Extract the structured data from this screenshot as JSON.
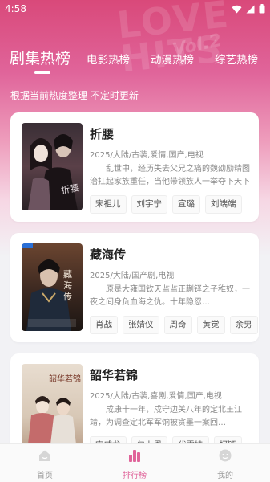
{
  "status_bar": {
    "time": "4:58"
  },
  "tabs": [
    {
      "label": "剧集热榜",
      "active": true
    },
    {
      "label": "电影热榜",
      "active": false
    },
    {
      "label": "动漫热榜",
      "active": false
    },
    {
      "label": "综艺热榜",
      "active": false
    }
  ],
  "subtitle": "根据当前热度整理 不定时更新",
  "items": [
    {
      "title": "折腰",
      "meta": "2025/大陆/古装,爱情,国产,电视",
      "description": "乱世中，经历失去父兄之痛的魏劭励精图治扛起家族重任，当他带领族人一举夺下天下大半江山之时，",
      "cast": [
        "宋祖儿",
        "刘宇宁",
        "宣璐",
        "刘端端"
      ]
    },
    {
      "title": "藏海传",
      "meta": "2025/大陆/国产剧,电视",
      "description": "原是大雍国钦天监监正蒯铎之子稚奴，一夜之间身负血海之仇。十年隐忍…",
      "cast": [
        "肖战",
        "张婧仪",
        "周奇",
        "黄觉",
        "余男"
      ]
    },
    {
      "title": "韶华若锦",
      "meta": "2025/大陆/古装,喜剧,爱情,国产,电视",
      "description": "成康十一年，戍守边关八年的定北王江靖，为调查定北军军饷被贪墨一案回…",
      "cast": [
        "宋威龙",
        "包上恩",
        "代露娃",
        "柯颖"
      ]
    }
  ],
  "bottom_nav": [
    {
      "label": "首页",
      "icon": "home-icon",
      "active": false
    },
    {
      "label": "排行榜",
      "icon": "ranking-icon",
      "active": true
    },
    {
      "label": "我的",
      "icon": "profile-icon",
      "active": false
    }
  ],
  "colors": {
    "accent": "#e0649a",
    "hero_top": "#d9497a"
  }
}
